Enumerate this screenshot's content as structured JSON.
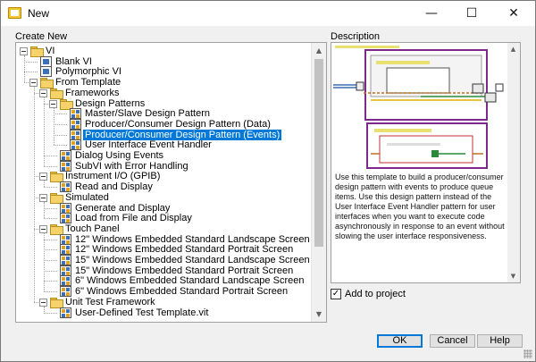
{
  "window": {
    "title": "New"
  },
  "titlebar": {
    "minimize_glyph": "—",
    "maximize_glyph": "☐",
    "close_glyph": "✕"
  },
  "create_new": {
    "label": "Create New",
    "items": [
      {
        "label": "VI",
        "icon": "folder-icon",
        "level": 0,
        "expanded": true
      },
      {
        "label": "Blank VI",
        "icon": "vi-icon",
        "level": 1
      },
      {
        "label": "Polymorphic VI",
        "icon": "vi-icon",
        "level": 1
      },
      {
        "label": "From Template",
        "icon": "folder-icon",
        "level": 1,
        "expanded": true
      },
      {
        "label": "Frameworks",
        "icon": "folder-icon",
        "level": 2,
        "expanded": true
      },
      {
        "label": "Design Patterns",
        "icon": "folder-icon",
        "level": 3,
        "expanded": true
      },
      {
        "label": "Master/Slave Design Pattern",
        "icon": "template-icon",
        "level": 4
      },
      {
        "label": "Producer/Consumer Design Pattern (Data)",
        "icon": "template-icon",
        "level": 4
      },
      {
        "label": "Producer/Consumer Design Pattern (Events)",
        "icon": "template-icon",
        "level": 4,
        "selected": true
      },
      {
        "label": "User Interface Event Handler",
        "icon": "template-icon",
        "level": 4
      },
      {
        "label": "Dialog Using Events",
        "icon": "template-icon",
        "level": 3
      },
      {
        "label": "SubVI with Error Handling",
        "icon": "template-icon",
        "level": 3
      },
      {
        "label": "Instrument I/O (GPIB)",
        "icon": "folder-icon",
        "level": 2,
        "expanded": true
      },
      {
        "label": "Read and Display",
        "icon": "template-icon",
        "level": 3
      },
      {
        "label": "Simulated",
        "icon": "folder-icon",
        "level": 2,
        "expanded": true
      },
      {
        "label": "Generate and Display",
        "icon": "template-icon",
        "level": 3
      },
      {
        "label": "Load from File and Display",
        "icon": "template-icon",
        "level": 3
      },
      {
        "label": "Touch Panel",
        "icon": "folder-icon",
        "level": 2,
        "expanded": true
      },
      {
        "label": "12\" Windows Embedded Standard Landscape Screen",
        "icon": "template-icon",
        "level": 3
      },
      {
        "label": "12\" Windows Embedded Standard Portrait Screen",
        "icon": "template-icon",
        "level": 3
      },
      {
        "label": "15\" Windows Embedded Standard Landscape Screen",
        "icon": "template-icon",
        "level": 3
      },
      {
        "label": "15\" Windows Embedded Standard Portrait Screen",
        "icon": "template-icon",
        "level": 3
      },
      {
        "label": "6\" Windows Embedded Standard Landscape Screen",
        "icon": "template-icon",
        "level": 3
      },
      {
        "label": "6\" Windows Embedded Standard Portrait Screen",
        "icon": "template-icon",
        "level": 3
      },
      {
        "label": "Unit Test Framework",
        "icon": "folder-icon",
        "level": 2,
        "expanded": true
      },
      {
        "label": "User-Defined Test Template.vit",
        "icon": "template-icon",
        "level": 3
      }
    ]
  },
  "description": {
    "label": "Description",
    "text": "Use this template to build a producer/consumer design pattern with events to produce queue items. Use this design pattern instead of the User Interface Event Handler pattern for user interfaces when you want to execute code asynchronously in response to an event without slowing the user interface responsiveness."
  },
  "add_to_project": {
    "label": "Add to project",
    "checked": true,
    "check_glyph": "✓"
  },
  "buttons": {
    "ok": "OK",
    "cancel": "Cancel",
    "help": "Help"
  },
  "scroll": {
    "up": "▲",
    "down": "▼"
  }
}
